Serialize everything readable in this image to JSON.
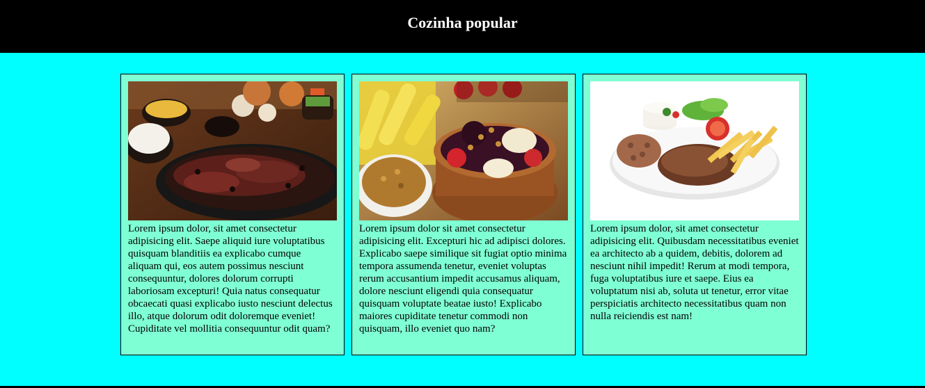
{
  "header": {
    "title": "Cozinha popular"
  },
  "colors": {
    "page_background": "#00ffff",
    "header_background": "#000000",
    "card_background": "#7fffd4"
  },
  "cards": [
    {
      "image_icon": "feijoada-photo",
      "text": "Lorem ipsum dolor, sit amet consectetur adipisicing elit. Saepe aliquid iure voluptatibus quisquam blanditiis ea explicabo cumque aliquam qui, eos autem possimus nesciunt consequuntur, dolores dolorum corrupti laboriosam excepturi! Quia natus consequatur obcaecati quasi explicabo iusto nesciunt delectus illo, atque dolorum odit doloremque eveniet! Cupiditate vel mollitia consequuntur odit quam?"
    },
    {
      "image_icon": "acai-bowl-photo",
      "text": "Lorem ipsum dolor sit amet consectetur adipisicing elit. Excepturi hic ad adipisci dolores. Explicabo saepe similique sit fugiat optio minima tempora assumenda tenetur, eveniet voluptas rerum accusantium impedit accusamus aliquam, dolore nesciunt eligendi quia consequatur quisquam voluptate beatae iusto! Explicabo maiores cupiditate tenetur commodi non quisquam, illo eveniet quo nam?"
    },
    {
      "image_icon": "prato-feito-photo",
      "text": "Lorem ipsum dolor, sit amet consectetur adipisicing elit. Quibusdam necessitatibus eveniet ea architecto ab a quidem, debitis, dolorem ad nesciunt nihil impedit! Rerum at modi tempora, fuga voluptatibus iure et saepe. Eius ea voluptatum nisi ab, soluta ut tenetur, error vitae perspiciatis architecto necessitatibus quam non nulla reiciendis est nam!"
    }
  ]
}
